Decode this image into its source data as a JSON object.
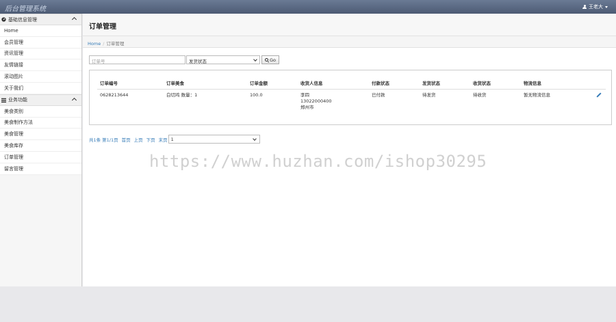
{
  "app": {
    "brand": "后台管理系统",
    "user_name": "王老大"
  },
  "sidebar": {
    "sections": [
      {
        "title": "基础信息管理",
        "items": [
          "Home",
          "会员管理",
          "资讯管理",
          "友情链接",
          "滚动图片",
          "关于我们"
        ]
      },
      {
        "title": "业务功能",
        "items": [
          "美食类别",
          "美食制作方法",
          "美食管理",
          "美食库存",
          "订单管理",
          "留言管理"
        ]
      }
    ]
  },
  "page": {
    "title": "订单管理"
  },
  "breadcrumb": {
    "home": "Home",
    "current": "订单管理"
  },
  "filter": {
    "order_no_placeholder": "订单号",
    "status_selected": "发货状态",
    "go_label": "Go"
  },
  "table": {
    "headers": [
      "订单编号",
      "订单美食",
      "订单金额",
      "收货人信息",
      "付款状态",
      "发货状态",
      "收货状态",
      "物流信息",
      ""
    ],
    "rows": [
      {
        "order_no": "0628213644",
        "food": "白切鸡  数量：1",
        "amount": "100.0",
        "receiver_name": "李四",
        "receiver_phone": "13022000400",
        "receiver_city": "郑州市",
        "pay_status": "已付款",
        "ship_status": "待发货",
        "receive_status": "待收货",
        "logistics": "暂无物流信息"
      }
    ]
  },
  "pager": {
    "total": "共1条",
    "page_of": "第1/1页",
    "first": "首页",
    "prev": "上页",
    "next": "下页",
    "last": "末页",
    "page_selected": "1"
  },
  "watermark": "https://www.huzhan.com/ishop30295",
  "colors": {
    "topbar": "#5a6882",
    "link": "#337ab7"
  }
}
